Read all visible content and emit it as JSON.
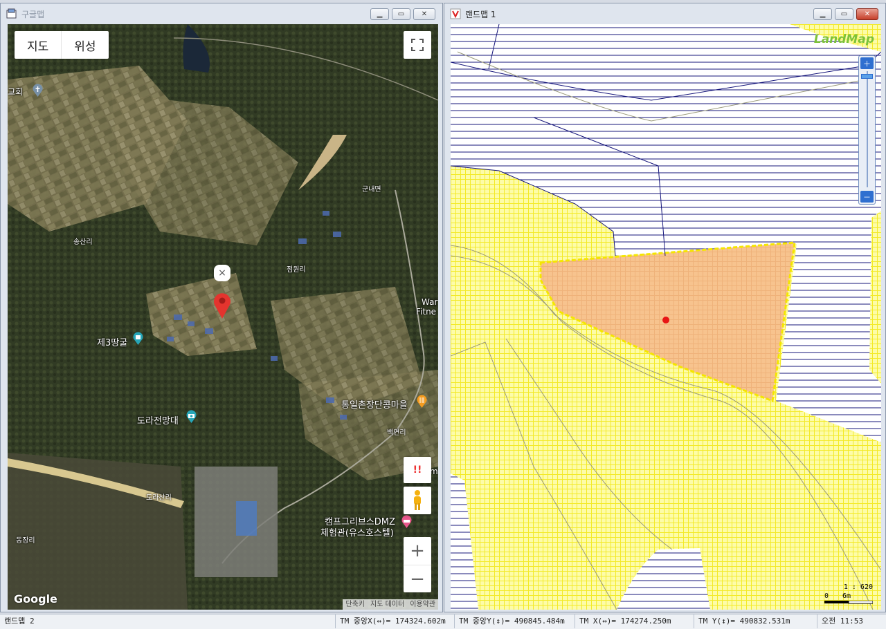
{
  "left_window": {
    "title": "구글맵",
    "map_type": {
      "map_label": "지도",
      "satellite_label": "위성"
    },
    "labels": {
      "church": "교회",
      "gunnae": "군내면",
      "songsanri": "송산리",
      "jeomwonri": "점원리",
      "war": "War",
      "fitne": "Fitne",
      "tunnel3": "제3땅굴",
      "dora_observatory": "도라전망대",
      "tongil_village": "통일촌장단콩마을",
      "baekyeonri": "백연리",
      "m_frag": "m",
      "dorasanri": "도라산리",
      "camp_greaves_1": "캠프그리브스DMZ",
      "camp_greaves_2": "체험관(유스호스텔)",
      "dongjangri": "동장리",
      "marker_close": "×"
    },
    "alert_glyph": "!!",
    "zoom_in": "+",
    "zoom_out": "−",
    "google_logo": "Google",
    "attribution": [
      "단축키",
      "지도 데이터",
      "이용약관"
    ]
  },
  "right_window": {
    "title": "랜드맵 1",
    "logo": "LandMap",
    "scale_ratio": "1 : 620",
    "scale_zero": "0",
    "scale_unit": "6m"
  },
  "status_bar": {
    "window_name": "랜드맵 2",
    "tm_center_x": "TM 중앙X(↔)= 174324.602m",
    "tm_center_y": "TM 중앙Y(↕)= 490845.484m",
    "tm_x": "TM X(↔)= 174274.250m",
    "tm_y": "TM Y(↕)= 490832.531m",
    "clock": "오전 11:53"
  },
  "colors": {
    "parcel_fill": "#f7c38e",
    "parcel_outline": "#f0e000",
    "grid_yellow": "#fbf45a",
    "hatch_blue": "#14147a"
  }
}
